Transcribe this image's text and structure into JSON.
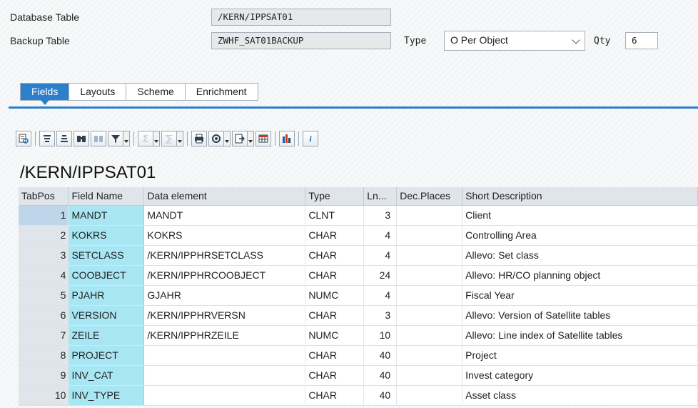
{
  "header": {
    "db_table_label": "Database Table",
    "db_table_value": "/KERN/IPPSAT01",
    "backup_table_label": "Backup Table",
    "backup_table_value": "ZWHF_SAT01BACKUP",
    "type_label": "Type",
    "type_value": "O Per Object",
    "qty_label": "Qty",
    "qty_value": "6"
  },
  "tabs": [
    {
      "label": "Fields",
      "active": true
    },
    {
      "label": "Layouts",
      "active": false
    },
    {
      "label": "Scheme",
      "active": false
    },
    {
      "label": "Enrichment",
      "active": false
    }
  ],
  "toolbar": {
    "icons": [
      "details-icon",
      "sort-ascending-icon",
      "sort-descending-icon",
      "find-icon",
      "find-next-icon",
      "filter-icon",
      "sum-icon",
      "subtotal-icon",
      "print-icon",
      "views-icon",
      "export-icon",
      "layout-icon",
      "graphic-icon",
      "info-icon"
    ]
  },
  "table_title": "/KERN/IPPSAT01",
  "grid": {
    "columns": [
      "TabPos",
      "Field Name",
      "Data element",
      "Type",
      "Ln...",
      "Dec.Places",
      "Short Description"
    ],
    "rows": [
      {
        "pos": "1",
        "field": "MANDT",
        "element": "MANDT",
        "type": "CLNT",
        "len": "3",
        "dec": "",
        "desc": "Client"
      },
      {
        "pos": "2",
        "field": "KOKRS",
        "element": "KOKRS",
        "type": "CHAR",
        "len": "4",
        "dec": "",
        "desc": "Controlling Area"
      },
      {
        "pos": "3",
        "field": "SETCLASS",
        "element": "/KERN/IPPHRSETCLASS",
        "type": "CHAR",
        "len": "4",
        "dec": "",
        "desc": "Allevo: Set class"
      },
      {
        "pos": "4",
        "field": "COOBJECT",
        "element": "/KERN/IPPHRCOOBJECT",
        "type": "CHAR",
        "len": "24",
        "dec": "",
        "desc": "Allevo: HR/CO planning object"
      },
      {
        "pos": "5",
        "field": "PJAHR",
        "element": "GJAHR",
        "type": "NUMC",
        "len": "4",
        "dec": "",
        "desc": "Fiscal Year"
      },
      {
        "pos": "6",
        "field": "VERSION",
        "element": "/KERN/IPPHRVERSN",
        "type": "CHAR",
        "len": "3",
        "dec": "",
        "desc": "Allevo: Version of Satellite tables"
      },
      {
        "pos": "7",
        "field": "ZEILE",
        "element": "/KERN/IPPHRZEILE",
        "type": "NUMC",
        "len": "10",
        "dec": "",
        "desc": "Allevo: Line index of Satellite tables"
      },
      {
        "pos": "8",
        "field": "PROJECT",
        "element": "",
        "type": "CHAR",
        "len": "40",
        "dec": "",
        "desc": "Project"
      },
      {
        "pos": "9",
        "field": "INV_CAT",
        "element": "",
        "type": "CHAR",
        "len": "40",
        "dec": "",
        "desc": "Invest category"
      },
      {
        "pos": "10",
        "field": "INV_TYPE",
        "element": "",
        "type": "CHAR",
        "len": "40",
        "dec": "",
        "desc": "Asset class"
      }
    ]
  }
}
